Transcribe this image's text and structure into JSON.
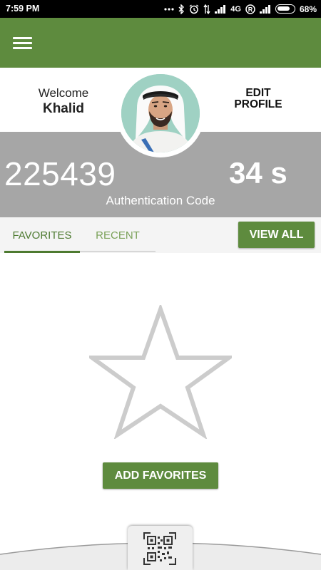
{
  "status_bar": {
    "time": "7:59 PM",
    "network": "4G",
    "battery": "68%",
    "icons": [
      "more-dots-icon",
      "bluetooth-icon",
      "alarm-icon",
      "data-arrows-icon",
      "signal-icon",
      "network-4g",
      "roaming-r-icon",
      "signal-icon-2",
      "battery-icon"
    ]
  },
  "app_bar": {
    "menu_icon": "hamburger-menu-icon",
    "color": "#5e8b3e"
  },
  "profile": {
    "welcome_label": "Welcome",
    "name": "Khalid",
    "edit_line1": "EDIT",
    "edit_line2": "PROFILE",
    "avatar": "user-avatar-photo"
  },
  "auth": {
    "code": "225439",
    "timer": "34 s",
    "label": "Authentication Code"
  },
  "tabs": [
    {
      "label": "FAVORITES",
      "active": true
    },
    {
      "label": "RECENT",
      "active": false
    }
  ],
  "view_all": "VIEW ALL",
  "empty_state": {
    "icon": "star-outline-icon",
    "button": "ADD FAVORITES"
  },
  "bottom": {
    "icon": "qr-code-icon"
  },
  "colors": {
    "primary": "#5e8b3e",
    "gray_band": "#a6a6a6",
    "tab_active": "#4d7a30",
    "tab_inactive": "#7aa158"
  }
}
